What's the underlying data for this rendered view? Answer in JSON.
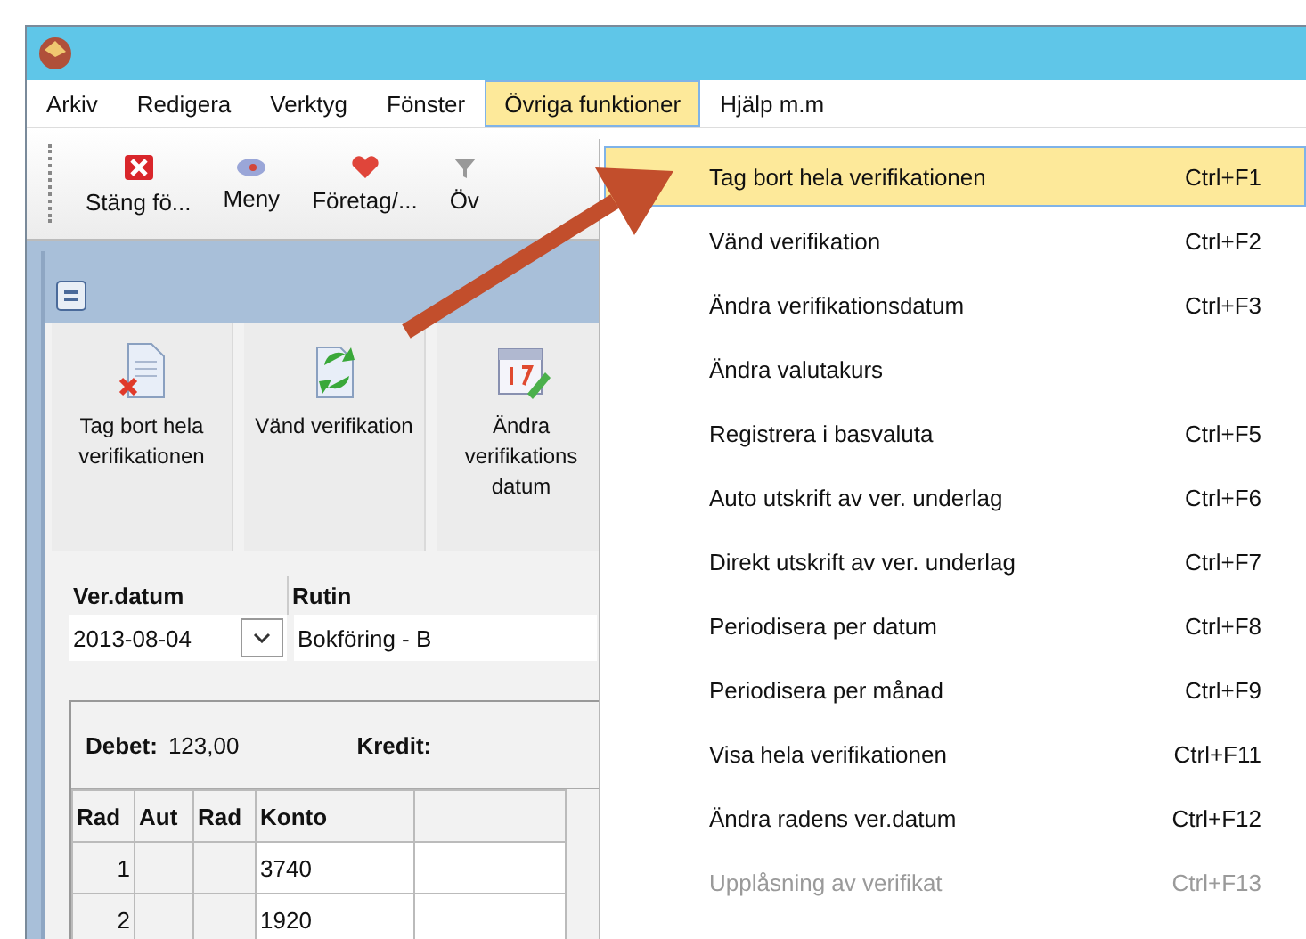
{
  "menubar": [
    {
      "label": "Arkiv",
      "selected": false
    },
    {
      "label": "Redigera",
      "selected": false
    },
    {
      "label": "Verktyg",
      "selected": false
    },
    {
      "label": "Fönster",
      "selected": false
    },
    {
      "label": "Övriga funktioner",
      "selected": true
    },
    {
      "label": "Hjälp m.m",
      "selected": false
    }
  ],
  "toolbar": [
    {
      "label": "Stäng fö...",
      "kind": "close"
    },
    {
      "label": "Meny",
      "kind": "menu"
    },
    {
      "label": "Företag/...",
      "kind": "company"
    },
    {
      "label": "Öv",
      "kind": "other"
    }
  ],
  "actions": [
    {
      "label": "Tag bort hela verifikationen",
      "kind": "delete"
    },
    {
      "label": "Vänd verifikation",
      "kind": "reverse"
    },
    {
      "label": "Ändra verifikations datum",
      "kind": "date"
    }
  ],
  "fields": [
    {
      "label": "Ver.datum",
      "value": "2013-08-04",
      "kind": "dropdown"
    },
    {
      "label": "Rutin",
      "value": "Bokföring - B",
      "kind": "text"
    }
  ],
  "summary": [
    {
      "label": "Debet:",
      "value": "123,00"
    },
    {
      "label": "Kredit:"
    }
  ],
  "table": {
    "columns": [
      "Rad",
      "Aut",
      "Rad",
      "Konto",
      null
    ],
    "rows": [
      [
        "1",
        null,
        null,
        "3740",
        null
      ],
      [
        "2",
        null,
        null,
        "1920",
        null
      ]
    ]
  },
  "dropdown": [
    {
      "label": "Tag bort hela verifikationen",
      "shortcut": "Ctrl+F1",
      "selected": true,
      "disabled": false
    },
    {
      "label": "Vänd verifikation",
      "shortcut": "Ctrl+F2",
      "selected": false,
      "disabled": false
    },
    {
      "label": "Ändra verifikationsdatum",
      "shortcut": "Ctrl+F3",
      "selected": false,
      "disabled": false
    },
    {
      "label": "Ändra valutakurs",
      "selected": false,
      "disabled": false
    },
    {
      "label": "Registrera i basvaluta",
      "shortcut": "Ctrl+F5",
      "selected": false,
      "disabled": false
    },
    {
      "label": "Auto utskrift av ver. underlag",
      "shortcut": "Ctrl+F6",
      "selected": false,
      "disabled": false
    },
    {
      "label": "Direkt utskrift av ver. underlag",
      "shortcut": "Ctrl+F7",
      "selected": false,
      "disabled": false
    },
    {
      "label": "Periodisera per datum",
      "shortcut": "Ctrl+F8",
      "selected": false,
      "disabled": false
    },
    {
      "label": "Periodisera per månad",
      "shortcut": "Ctrl+F9",
      "selected": false,
      "disabled": false
    },
    {
      "label": "Visa hela verifikationen",
      "shortcut": "Ctrl+F11",
      "selected": false,
      "disabled": false
    },
    {
      "label": "Ändra radens ver.datum",
      "shortcut": "Ctrl+F12",
      "selected": false,
      "disabled": false
    },
    {
      "label": "Upplåsning av verifikat",
      "shortcut": "Ctrl+F13",
      "selected": false,
      "disabled": true
    }
  ]
}
